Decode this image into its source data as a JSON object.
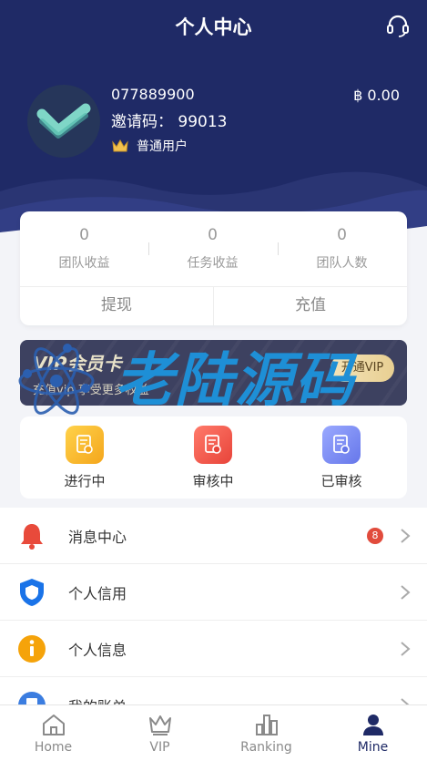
{
  "header": {
    "title": "个人中心",
    "support_icon": "headset-icon"
  },
  "profile": {
    "phone": "077889900",
    "invite_label": "邀请码：",
    "invite_code": "99013",
    "level": "普通用户",
    "balance": "฿ 0.00"
  },
  "stats": [
    {
      "value": "0",
      "label": "团队收益"
    },
    {
      "value": "0",
      "label": "任务收益"
    },
    {
      "value": "0",
      "label": "团队人数"
    }
  ],
  "actions": {
    "withdraw": "提现",
    "recharge": "充值"
  },
  "vip": {
    "title": "VIP会员卡",
    "subtitle": "充值vip 享受更多权益",
    "button": "开通VIP"
  },
  "watermark": {
    "text": "老陆源码"
  },
  "tasks": [
    {
      "label": "进行中",
      "color": "#f6b72c"
    },
    {
      "label": "审核中",
      "color": "#ee5a4f"
    },
    {
      "label": "已审核",
      "color": "#7b8df2"
    }
  ],
  "menu": [
    {
      "label": "消息中心",
      "icon": "bell-icon",
      "color": "#e84a3b",
      "badge": "8"
    },
    {
      "label": "个人信用",
      "icon": "shield-icon",
      "color": "#1a73e8"
    },
    {
      "label": "个人信息",
      "icon": "info-icon",
      "color": "#f5a30a"
    },
    {
      "label": "我的账单",
      "icon": "bill-icon",
      "color": "#3b7de0"
    }
  ],
  "tabbar": [
    {
      "label": "Home",
      "icon": "home-icon"
    },
    {
      "label": "VIP",
      "icon": "crown-icon"
    },
    {
      "label": "Ranking",
      "icon": "bar-chart-icon"
    },
    {
      "label": "Mine",
      "icon": "user-icon",
      "active": true
    }
  ],
  "colors": {
    "primary": "#1f2a66",
    "watermark": "#1e8fd6"
  }
}
